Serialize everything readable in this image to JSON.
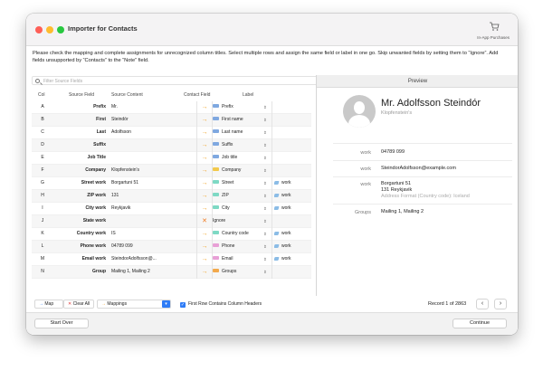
{
  "window": {
    "title": "Importer for Contacts",
    "purchases_label": "In-App Purchases"
  },
  "instructions": "Please check the mapping and complete assignments for unrecognized column titles. Select multiple rows and assign the same field or label in one go. Skip unwanted fields by setting them to “Ignore”. Add fields unsupported by “Contacts” to the “Note” field.",
  "search": {
    "placeholder": "Filter Source Fields"
  },
  "columns": {
    "col": "Col",
    "source_field": "Source Field",
    "source_content": "Source Content",
    "contact_field": "Contact Field",
    "label": "Label"
  },
  "rows": [
    {
      "col": "A",
      "source": "Prefix",
      "content": "Mr.",
      "arrow": "→",
      "field": "Prefix",
      "swatch": "#7fa8e0",
      "label": ""
    },
    {
      "col": "B",
      "source": "First",
      "content": "Steindór",
      "arrow": "→",
      "field": "First name",
      "swatch": "#7fa8e0",
      "label": ""
    },
    {
      "col": "C",
      "source": "Last",
      "content": "Adolfsson",
      "arrow": "→",
      "field": "Last name",
      "swatch": "#7fa8e0",
      "label": ""
    },
    {
      "col": "D",
      "source": "Suffix",
      "content": "",
      "arrow": "→",
      "field": "Suffix",
      "swatch": "#7fa8e0",
      "label": ""
    },
    {
      "col": "E",
      "source": "Job Title",
      "content": "",
      "arrow": "→",
      "field": "Job title",
      "swatch": "#7fa8e0",
      "label": ""
    },
    {
      "col": "F",
      "source": "Company",
      "content": "Klopfenstein's",
      "arrow": "→",
      "field": "Company",
      "swatch": "#f2c94c",
      "label": ""
    },
    {
      "col": "G",
      "source": "Street work",
      "content": "Borgartuni 51",
      "arrow": "→",
      "field": "Street",
      "swatch": "#7ed9c4",
      "label": "work"
    },
    {
      "col": "H",
      "source": "ZIP work",
      "content": "131",
      "arrow": "→",
      "field": "ZIP",
      "swatch": "#7ed9c4",
      "label": "work"
    },
    {
      "col": "I",
      "source": "City work",
      "content": "Reykjavik",
      "arrow": "→",
      "field": "City",
      "swatch": "#7ed9c4",
      "label": "work"
    },
    {
      "col": "J",
      "source": "State work",
      "content": "",
      "arrow": "✕",
      "field": "Ignore",
      "swatch": "",
      "label": ""
    },
    {
      "col": "K",
      "source": "Country work",
      "content": "IS",
      "arrow": "→",
      "field": "Country code",
      "swatch": "#7ed9c4",
      "label": "work"
    },
    {
      "col": "L",
      "source": "Phone work",
      "content": "04789 099",
      "arrow": "→",
      "field": "Phone",
      "swatch": "#e8a0d6",
      "label": "work"
    },
    {
      "col": "M",
      "source": "Email work",
      "content": "SteindorAdolfsson@...",
      "arrow": "→",
      "field": "Email",
      "swatch": "#e8a0d6",
      "label": "work"
    },
    {
      "col": "N",
      "source": "Group",
      "content": "Mailing 1, Mailing 2",
      "arrow": "→",
      "field": "Groups",
      "swatch": "#f2a94c",
      "label": ""
    }
  ],
  "preview": {
    "header": "Preview",
    "name": "Mr. Adolfsson Steindór",
    "company": "Klopfenstein's",
    "phone_label": "work",
    "phone": "04789 099",
    "email_label": "work",
    "email": "SteindorAdolfsson@example.com",
    "address_label": "work",
    "address_line1": "Borgartuni 51",
    "address_line2": "131 Reykjavik",
    "address_note": "Address Format (Country code): Iceland",
    "groups_label": "Groups",
    "groups": "Mailing 1, Mailing 2"
  },
  "toolbar": {
    "map_label": "Map",
    "clear_label": "Clear All",
    "mappings_label": "Mappings",
    "first_row_label": "First Row Contains Column Headers",
    "record_label": "Record 1 of 2863"
  },
  "footer": {
    "start_over": "Start Over",
    "continue": "Continue"
  },
  "colors": {
    "accent": "#2f7cf6",
    "arrow_orange": "#f0a020",
    "ignore_orange": "#f07a20",
    "label_tag": "#8bbce6"
  }
}
